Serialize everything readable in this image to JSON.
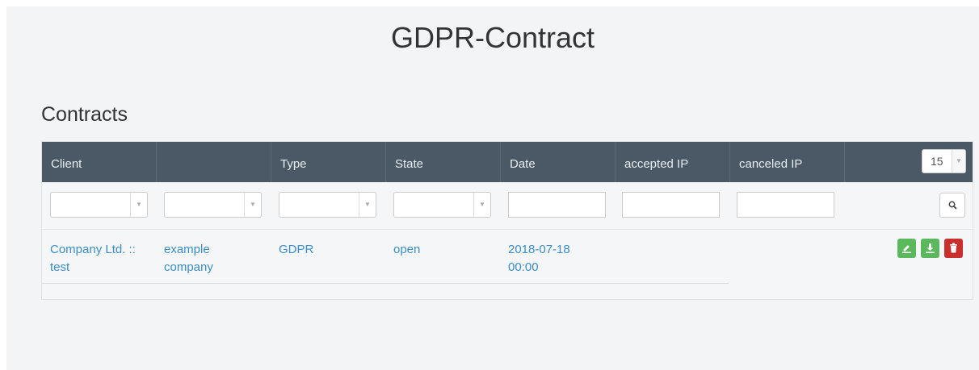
{
  "page": {
    "title": "GDPR-Contract"
  },
  "section": {
    "title": "Contracts"
  },
  "table": {
    "columns": [
      "Client",
      "",
      "Type",
      "State",
      "Date",
      "accepted IP",
      "canceled IP"
    ],
    "page_size": "15",
    "filters": {
      "accepted_ip_value": "",
      "canceled_ip_value": "",
      "date_value": ""
    },
    "rows": [
      {
        "client_line1": "Company Ltd. ::",
        "client_line2": "test",
        "company_line1": "example",
        "company_line2": "company",
        "type": "GDPR",
        "state": "open",
        "date_line1": "2018-07-18",
        "date_line2": "00:00",
        "accepted_ip": "",
        "canceled_ip": ""
      }
    ],
    "action_icons": [
      "signature-icon",
      "download-icon",
      "trash-icon"
    ]
  },
  "colors": {
    "header_bg": "#4a5965",
    "link": "#3b8ec4",
    "success": "#5cb85c",
    "danger": "#c9302c",
    "page_bg": "#f2f4f6"
  }
}
